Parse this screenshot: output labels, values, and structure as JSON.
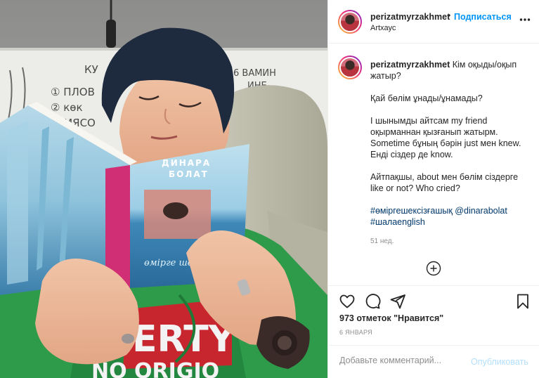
{
  "post": {
    "username": "perizatmyrzakhmet",
    "follow_label": "Подписаться",
    "separator": "•",
    "location": "Artxаус",
    "more_icon": "more-horizontal-icon",
    "photo": {
      "whiteboard_lines": [
        "КУ",
        "① ПЛОВ",
        "② көк",
        "③ МЯСО",
        "6 ВАМИН",
        "ИНЕ"
      ],
      "book_author_line1": "ДИНАРА",
      "book_author_line2": "БОЛАТ",
      "book_title": "өмірге шексіз ғашық",
      "shirt_text": "ERTY",
      "shirt_text_bottom": "NO ORIGIO"
    },
    "caption": {
      "first_line": "Кім оқыды/оқып жатыр?",
      "paragraphs": [
        "Қай бөлім ұнады/ұнамады?",
        "І шынымды айтсам my friend оқырманнан қызғанып жатырм. Sometime бұның бәрін just мен knew. Енді сіздер де know.",
        "Айтпақшы, about мен бөлім сіздерге like or not? Who cried?"
      ],
      "hashtag1": "#өміргешексізғашық",
      "mention": "@dinarabolat",
      "hashtag2": "#шалаenglish",
      "time_ago": "51 нед."
    },
    "likes_text": "973 отметок \"Нравится\"",
    "date": "6 ЯНВАРЯ",
    "comment_placeholder": "Добавьте комментарий...",
    "publish_label": "Опубликовать",
    "colors": {
      "link_blue": "#0095f6",
      "hashtag": "#00376b",
      "muted": "#8e8e8e",
      "publish_disabled": "#b2dffc"
    }
  }
}
